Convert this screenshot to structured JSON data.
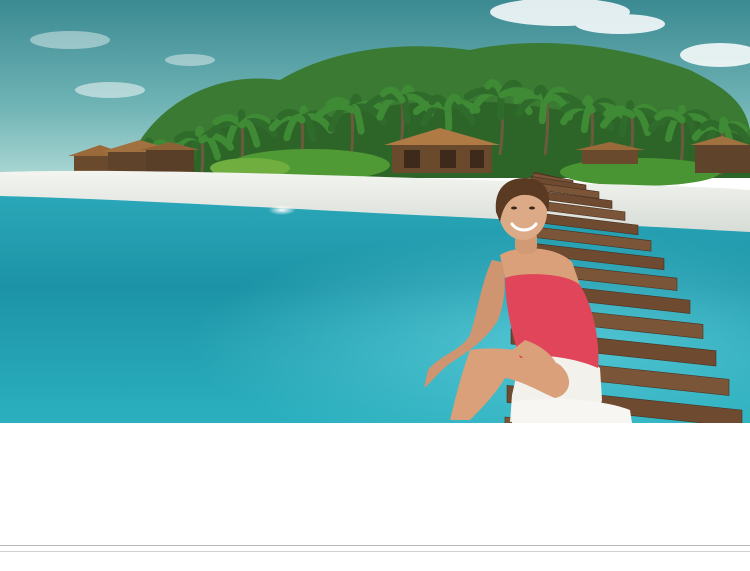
{
  "scene": {
    "subject": "woman-sitting-on-pier",
    "setting": "tropical-island-resort",
    "colors": {
      "sky_top": "#3f8f96",
      "sky_bottom": "#8fc9c8",
      "water_deep": "#1a8fa3",
      "water_light": "#44bfd0",
      "sand": "#e9ebe7",
      "palm_green": "#2f6b2a",
      "hut_roof": "#9a6a3a",
      "pier_wood": "#7a5538",
      "top_red": "#e0455a",
      "shorts_white": "#f3f1ec",
      "skin": "#d9a07a",
      "hair": "#5a3a22"
    }
  }
}
